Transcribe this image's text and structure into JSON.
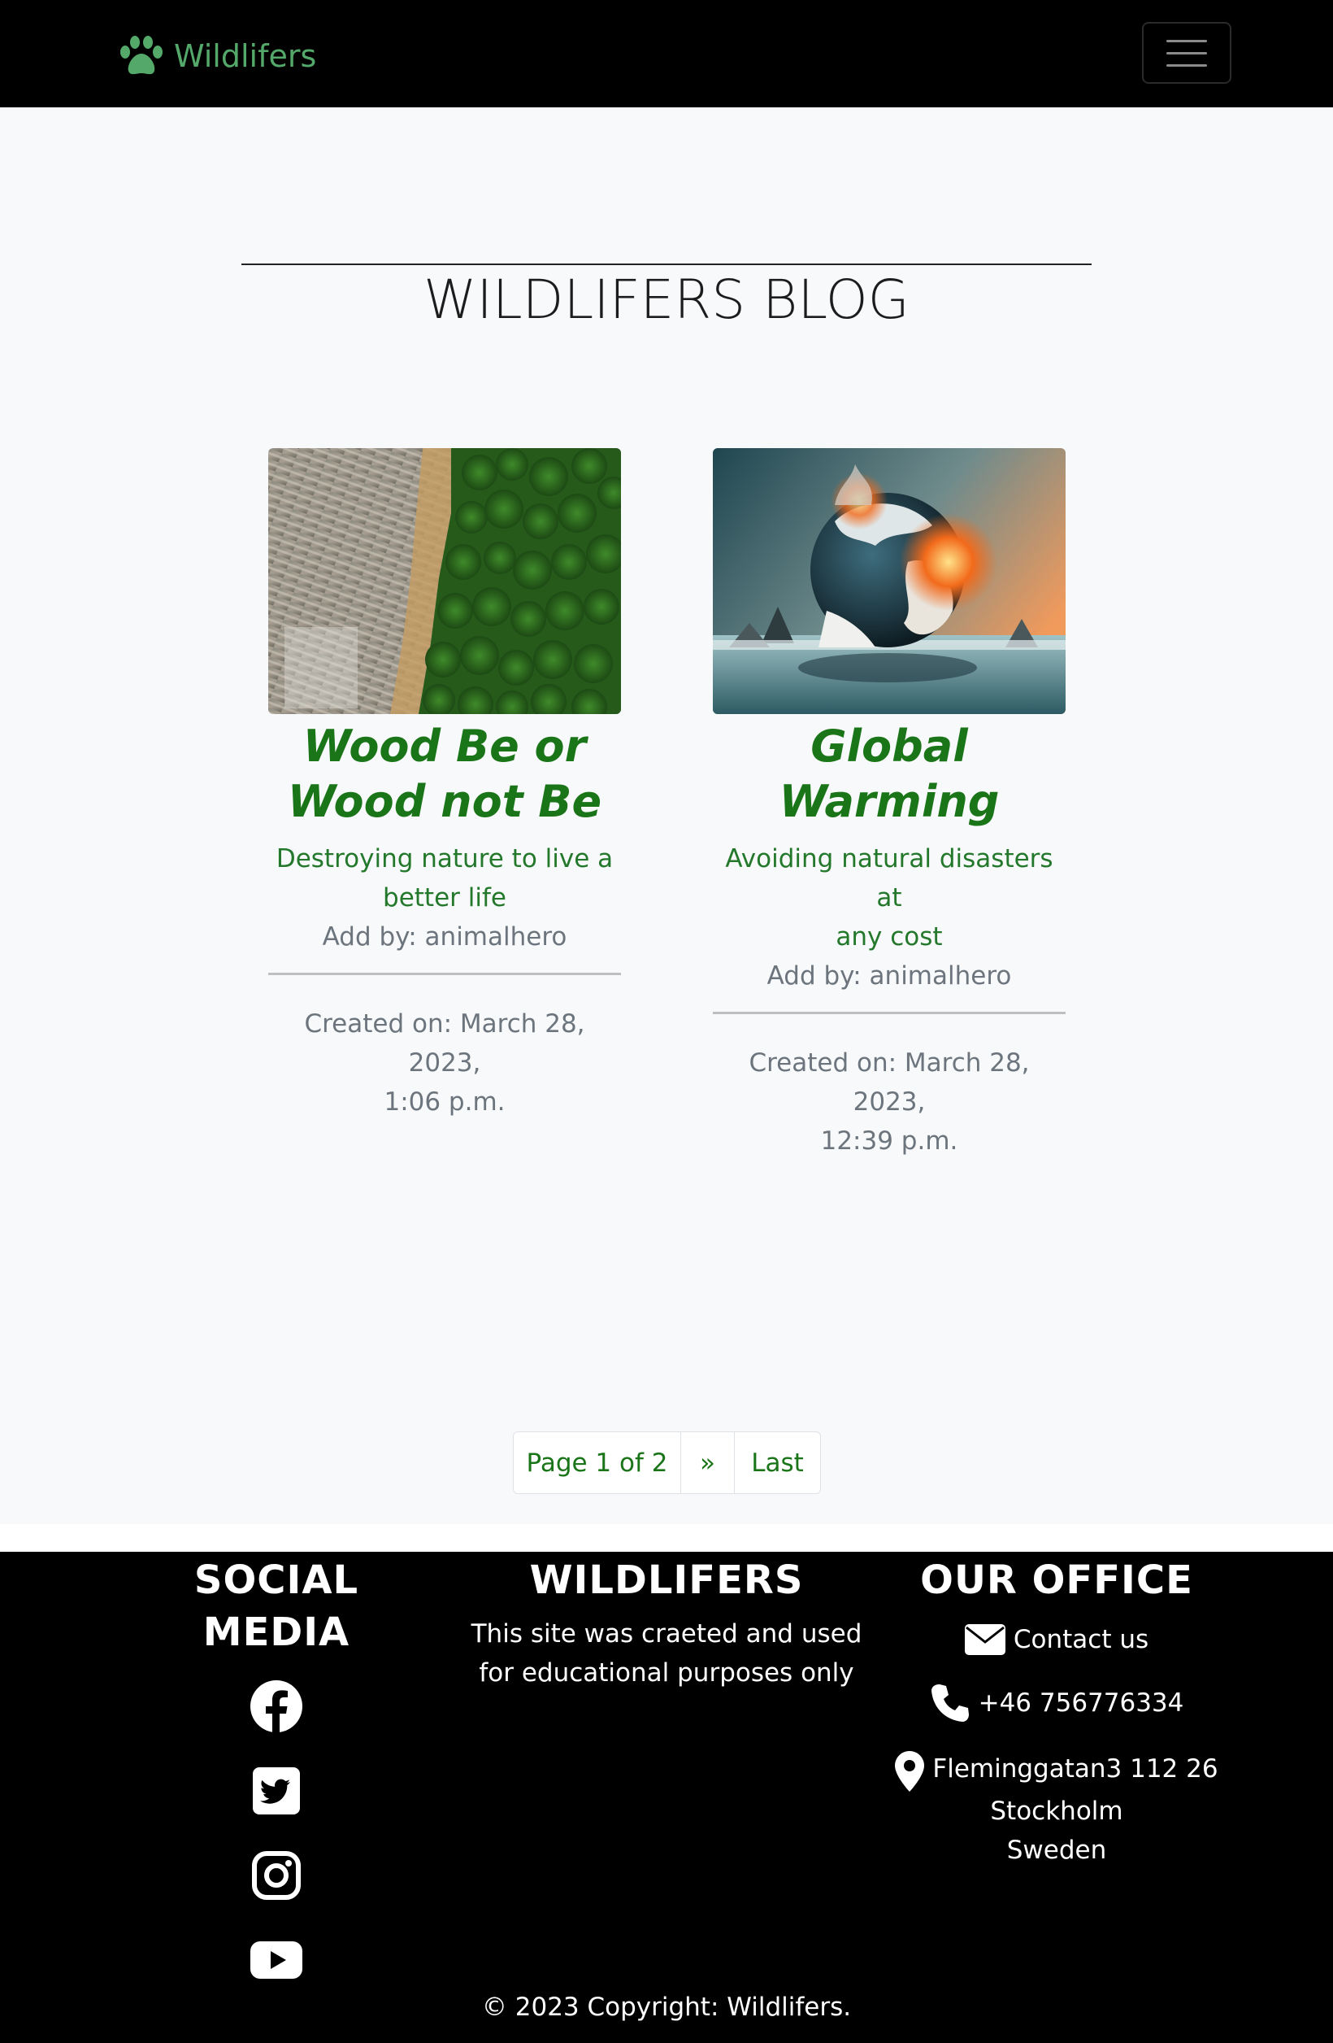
{
  "nav": {
    "brand": "Wildlifers",
    "brand_icon": "paw-icon",
    "toggler_icon": "hamburger-menu-icon"
  },
  "blog": {
    "title": "WILDLIFERS BLOG"
  },
  "posts": [
    {
      "title_line1": "Wood Be or",
      "title_line2": "Wood not Be",
      "excerpt_line1": "Destroying nature to live a",
      "excerpt_line2": "better life",
      "author": "Add by: animalhero",
      "created_line1": "Created on: March 28, 2023,",
      "created_line2": "1:06 p.m."
    },
    {
      "title_line1": "Global",
      "title_line2": "Warming",
      "excerpt_line1": "Avoiding natural disasters at",
      "excerpt_line2": "any cost",
      "author": "Add by: animalhero",
      "created_line1": "Created on: March 28, 2023,",
      "created_line2": "12:39 p.m."
    }
  ],
  "pagination": {
    "current": "Page 1 of 2",
    "next": "»",
    "last": "Last"
  },
  "footer": {
    "social_heading": "SOCIAL MEDIA",
    "social_icons": [
      "facebook-icon",
      "twitter-icon",
      "instagram-icon",
      "youtube-icon"
    ],
    "about_heading": "WILDLIFERS",
    "about_line1": "This site was craeted and used",
    "about_line2": "for educational purposes only",
    "office_heading": "OUR OFFICE",
    "contact": "Contact us",
    "phone": "+46 756776334",
    "address_line1": "Fleminggatan3 112 26",
    "address_line2": "Stockholm",
    "address_line3": "Sweden",
    "copyright": "© 2023 Copyright: Wildlifers."
  },
  "colors": {
    "brand": "#53a86a",
    "title_green": "#1a7518",
    "text_gray": "#6c757d",
    "page_bg": "#f8f9fa"
  }
}
